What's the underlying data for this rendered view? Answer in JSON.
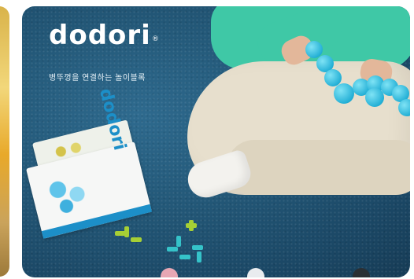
{
  "carousel": {
    "current_slide": {
      "brand_text": "dodori",
      "brand_mark": "®",
      "tagline": "병뚜껑을 연결하는 놀이블록",
      "box_label": "dodori"
    }
  },
  "colors": {
    "carpet": "#235878",
    "shirt": "#3fc8a6",
    "pants": "#e7dfcd",
    "toy": "#24b0d6",
    "box_accent": "#1c8fc8"
  }
}
